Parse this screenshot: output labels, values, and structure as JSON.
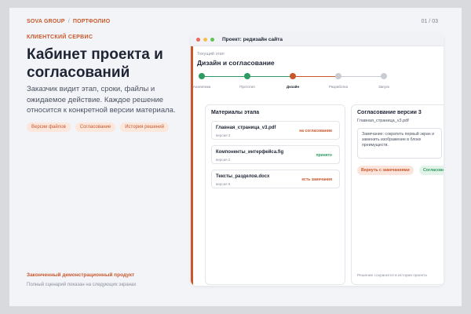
{
  "header": {
    "brand": "SOVA GROUP",
    "separator": "/",
    "section": "ПОРТФОЛИО",
    "pager": "01 / 03"
  },
  "intro": {
    "eyebrow": "КЛИЕНТСКИЙ СЕРВИС",
    "headline": "Кабинет проекта и согласований",
    "lede": "Заказчик видит этап, сроки, файлы и ожидаемое действие. Каждое решение относится к конкретной версии материала.",
    "chips": [
      "Версии файлов",
      "Согласование",
      "История решений"
    ]
  },
  "footer": {
    "title": "Законченный демонстрационный продукт",
    "subtitle": "Полный сценарий показан на следующих экранах"
  },
  "window": {
    "title": "Проект: редизайн сайта",
    "dots": [
      "#ec6a5e",
      "#f4be4f",
      "#61c454"
    ],
    "stage_label": "Текущий этап",
    "stage_name": "Дизайн и согласование"
  },
  "progress": {
    "steps": [
      {
        "label": "Аналитика",
        "state": "done"
      },
      {
        "label": "Прототип",
        "state": "done"
      },
      {
        "label": "Дизайн",
        "state": "current"
      },
      {
        "label": "Разработка",
        "state": "pending"
      },
      {
        "label": "Запуск",
        "state": "pending"
      }
    ]
  },
  "materials": {
    "title": "Материалы этапа",
    "files": [
      {
        "name": "Главная_страница_v3.pdf",
        "version": "версия 3",
        "status": "на согласовании",
        "status_color": "#c8582b"
      },
      {
        "name": "Компоненты_интерфейса.fig",
        "version": "версия 2",
        "status": "принято",
        "status_color": "#2f9a62"
      },
      {
        "name": "Тексты_разделов.docx",
        "version": "версия 5",
        "status": "есть замечания",
        "status_color": "#c8582b"
      }
    ]
  },
  "approval": {
    "title": "Согласование версии 3",
    "file": "Главная_страница_v3.pdf",
    "comment": "Замечание: сократить первый экран и заменить изображение в блоке преимуществ.",
    "reject_label": "Вернуть с замечаниями",
    "approve_label": "Согласовать",
    "note": "Решение сохранится в истории проекта"
  },
  "colors": {
    "accent": "#c8582b",
    "success": "#2f9a62",
    "pending": "#c9ccd3"
  }
}
